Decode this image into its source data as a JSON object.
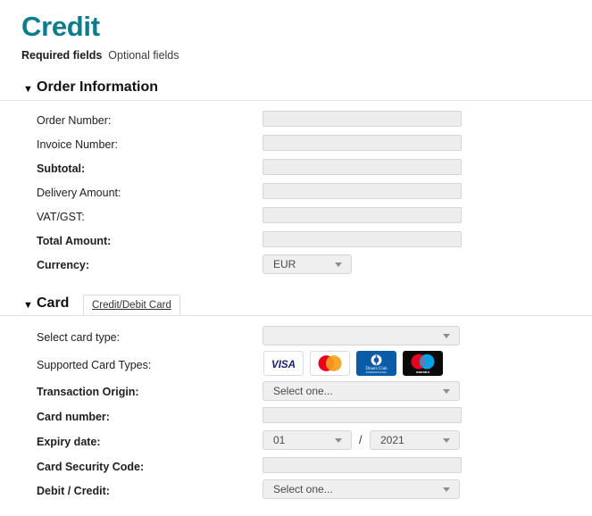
{
  "header": {
    "title": "Credit",
    "legend_required": "Required fields",
    "legend_optional": "Optional fields"
  },
  "sections": [
    {
      "id": "order-information",
      "caret": "▼",
      "title": "Order Information",
      "rows": [
        {
          "label": "Order Number:",
          "required": false,
          "control": "text",
          "value": ""
        },
        {
          "label": "Invoice Number:",
          "required": false,
          "control": "text",
          "value": ""
        },
        {
          "label": "Subtotal:",
          "required": true,
          "control": "text",
          "value": ""
        },
        {
          "label": "Delivery Amount:",
          "required": false,
          "control": "text",
          "value": ""
        },
        {
          "label": "VAT/GST:",
          "required": false,
          "control": "text",
          "value": ""
        },
        {
          "label": "Total Amount:",
          "required": true,
          "control": "text",
          "value": ""
        },
        {
          "label": "Currency:",
          "required": true,
          "control": "select",
          "value": "EUR"
        }
      ]
    },
    {
      "id": "card",
      "caret": "▼",
      "title": "Card",
      "tab_label": "Credit/Debit Card",
      "rows": [
        {
          "label": "Select card type:",
          "required": false,
          "control": "select",
          "value": ""
        },
        {
          "label": "Supported Card Types:",
          "required": false,
          "control": "logos",
          "value": ""
        },
        {
          "label": "Transaction Origin:",
          "required": true,
          "control": "select",
          "value": "Select one..."
        },
        {
          "label": "Card number:",
          "required": true,
          "control": "text",
          "value": ""
        },
        {
          "label": "Expiry date:",
          "required": true,
          "control": "expiry",
          "value": ""
        },
        {
          "label": "Card Security Code:",
          "required": true,
          "control": "text",
          "value": ""
        },
        {
          "label": "Debit / Credit:",
          "required": true,
          "control": "select",
          "value": "Select one..."
        }
      ]
    }
  ],
  "expiry": {
    "month": "01",
    "separator": "/",
    "year": "2021"
  },
  "supported_cards": [
    {
      "name": "visa",
      "label": "VISA"
    },
    {
      "name": "mastercard",
      "label": "mastercard"
    },
    {
      "name": "diners-club",
      "label": "Diners Club"
    },
    {
      "name": "maestro",
      "label": "maestro"
    }
  ],
  "colors": {
    "title_teal": "#0d7c8c",
    "field_bg": "#ededed",
    "field_border": "#d6d6d6",
    "rule": "#e2e2e2",
    "visa_blue": "#1a1f71",
    "mastercard_red": "#eb001b",
    "mastercard_orange": "#f79e1b",
    "diners_blue": "#0a5ca8",
    "maestro_red": "#eb001b",
    "maestro_blue": "#00a2e5"
  }
}
